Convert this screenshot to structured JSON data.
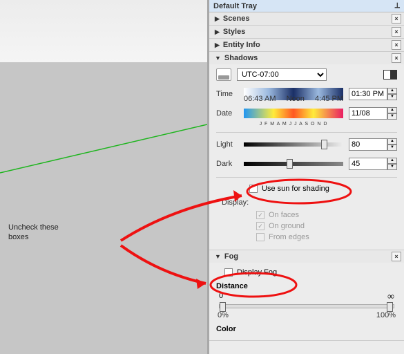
{
  "annotation": {
    "text_line1": "Uncheck these",
    "text_line2": "boxes"
  },
  "tray": {
    "title": "Default Tray"
  },
  "sections": {
    "scenes": "Scenes",
    "styles": "Styles",
    "entity_info": "Entity Info",
    "shadows": "Shadows",
    "fog": "Fog"
  },
  "shadows": {
    "timezone": "UTC-07:00",
    "time_label": "Time",
    "time_ticks": [
      "06:43 AM",
      "Noon",
      "4:45 PM"
    ],
    "time_value": "01:30 PM",
    "date_label": "Date",
    "months": "J F M A M J J A S O N D",
    "date_value": "11/08",
    "light_label": "Light",
    "light_value": "80",
    "dark_label": "Dark",
    "dark_value": "45",
    "use_sun_label": "Use sun for shading",
    "display_label": "Display:",
    "on_faces": "On faces",
    "on_ground": "On ground",
    "from_edges": "From edges"
  },
  "fog": {
    "display_fog": "Display Fog",
    "distance_label": "Distance",
    "range_min": "0",
    "range_max_sym": "∞",
    "tick_min": "0%",
    "tick_max": "100%",
    "color_label": "Color"
  }
}
